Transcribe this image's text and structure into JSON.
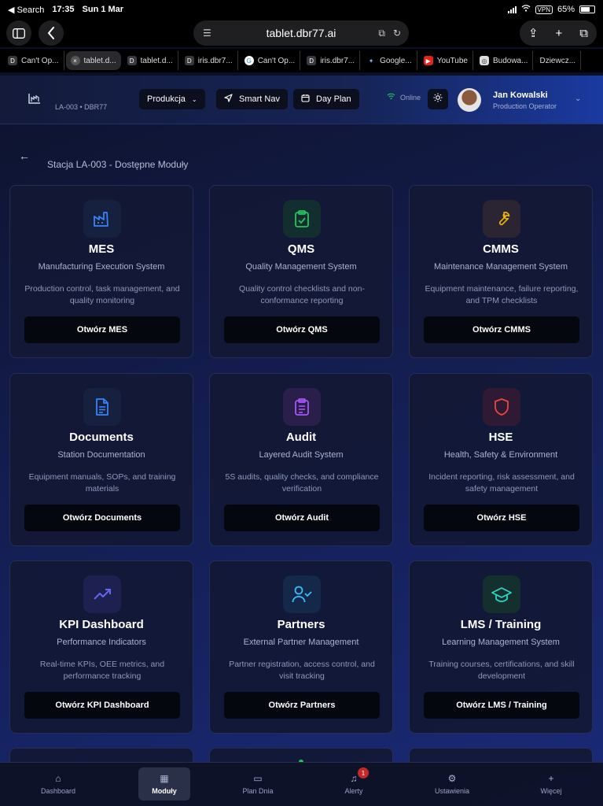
{
  "status_bar": {
    "back_label": "◀ Search",
    "time": "17:35",
    "date": "Sun 1 Mar",
    "vpn": "VPN",
    "battery": "65%"
  },
  "browser": {
    "url": "tablet.dbr77.ai",
    "tabs": [
      {
        "favicon": "D",
        "label": "Can't Op..."
      },
      {
        "favicon": "×",
        "label": "tablet.d..."
      },
      {
        "favicon": "D",
        "label": "tablet.d..."
      },
      {
        "favicon": "D",
        "label": "iris.dbr7..."
      },
      {
        "favicon": "G",
        "label": "Can't Op..."
      },
      {
        "favicon": "D",
        "label": "iris.dbr7..."
      },
      {
        "favicon": "✦",
        "label": "Google..."
      },
      {
        "favicon": "▶",
        "label": "YouTube"
      },
      {
        "favicon": "◎",
        "label": "Budowa..."
      },
      {
        "favicon": "",
        "label": "Dziewcz..."
      }
    ]
  },
  "header": {
    "station_code": "LA-003 • DBR77",
    "produkcja_label": "Produkcja",
    "smart_nav_label": "Smart Nav",
    "day_plan_label": "Day Plan",
    "online_label": "Online",
    "user_name": "Jan Kowalski",
    "user_role": "Production Operator"
  },
  "page": {
    "title": "Stacja LA-003 - Dostępne Moduły"
  },
  "modules": [
    {
      "title": "MES",
      "subtitle": "Manufacturing Execution System",
      "description": "Production control, task management, and quality monitoring",
      "button": "Otwórz MES",
      "icon": "factory-icon",
      "color": "#3b82f6",
      "bg": "#16203f"
    },
    {
      "title": "QMS",
      "subtitle": "Quality Management System",
      "description": "Quality control checklists and non-conformance reporting",
      "button": "Otwórz QMS",
      "icon": "clipboard-check-icon",
      "color": "#22c55e",
      "bg": "#132e2e"
    },
    {
      "title": "CMMS",
      "subtitle": "Maintenance Management System",
      "description": "Equipment maintenance, failure reporting, and TPM checklists",
      "button": "Otwórz CMMS",
      "icon": "wrench-icon",
      "color": "#eab308",
      "bg": "#2a2433"
    },
    {
      "title": "Documents",
      "subtitle": "Station Documentation",
      "description": "Equipment manuals, SOPs, and training materials",
      "button": "Otwórz Documents",
      "icon": "document-icon",
      "color": "#3b82f6",
      "bg": "#16203f"
    },
    {
      "title": "Audit",
      "subtitle": "Layered Audit System",
      "description": "5S audits, quality checks, and compliance verification",
      "button": "Otwórz Audit",
      "icon": "clipboard-list-icon",
      "color": "#a855f7",
      "bg": "#291f4a"
    },
    {
      "title": "HSE",
      "subtitle": "Health, Safety & Environment",
      "description": "Incident reporting, risk assessment, and safety management",
      "button": "Otwórz HSE",
      "icon": "shield-icon",
      "color": "#ef4444",
      "bg": "#2e1b33"
    },
    {
      "title": "KPI Dashboard",
      "subtitle": "Performance Indicators",
      "description": "Real-time KPIs, OEE metrics, and performance tracking",
      "button": "Otwórz KPI Dashboard",
      "icon": "trending-up-icon",
      "color": "#6366f1",
      "bg": "#1e2150"
    },
    {
      "title": "Partners",
      "subtitle": "External Partner Management",
      "description": "Partner registration, access control, and visit tracking",
      "button": "Otwórz Partners",
      "icon": "user-check-icon",
      "color": "#38bdf8",
      "bg": "#14284a"
    },
    {
      "title": "LMS / Training",
      "subtitle": "Learning Management System",
      "description": "Training courses, certifications, and skill development",
      "button": "Otwórz LMS / Training",
      "icon": "graduation-cap-icon",
      "color": "#2dd4bf",
      "bg": "#13302f"
    }
  ],
  "bottom_nav": {
    "dashboard": "Dashboard",
    "moduly": "Moduły",
    "plan_dnia": "Plan Dnia",
    "alerty": "Alerty",
    "alert_count": "1",
    "ustawienia": "Ustawienia",
    "wiecej": "Więcej"
  }
}
